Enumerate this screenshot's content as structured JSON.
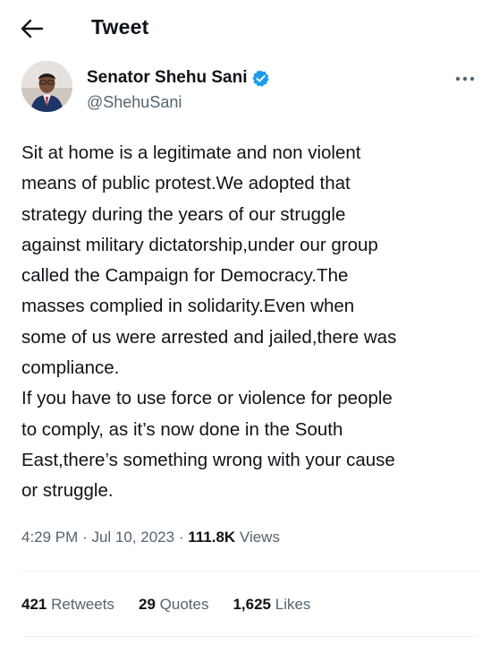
{
  "header": {
    "back_icon": "arrow-left-icon",
    "title": "Tweet"
  },
  "author": {
    "name": "Senator Shehu Sani",
    "handle": "@ShehuSani",
    "verified_icon": "verified-badge-icon",
    "verified_color": "#1d9bf0",
    "more_icon": "more-horizontal-icon"
  },
  "tweet": {
    "text": "Sit at home is a legitimate and non violent\nmeans of public protest.We adopted that\nstrategy during the years of our struggle\nagainst military dictatorship,under our group\ncalled the Campaign for Democracy.The\nmasses complied in solidarity.Even when\nsome of us were arrested and jailed,there was\ncompliance.\nIf you have to use force or violence for people\nto comply, as it’s now done in the South\nEast,there’s something wrong with your cause\nor struggle.",
    "time": "4:29 PM",
    "separator": "·",
    "date": "Jul 10, 2023",
    "views_count": "111.8K",
    "views_label": "Views"
  },
  "stats": {
    "retweets_count": "421",
    "retweets_label": "Retweets",
    "quotes_count": "29",
    "quotes_label": "Quotes",
    "likes_count": "1,625",
    "likes_label": "Likes"
  },
  "colors": {
    "text_primary": "#0f1419",
    "text_secondary": "#536471",
    "divider": "#eff3f4"
  }
}
